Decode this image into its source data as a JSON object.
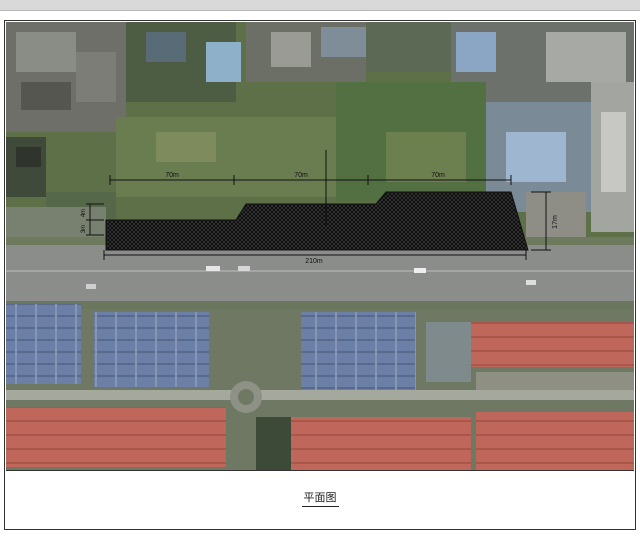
{
  "caption": "平面图",
  "dimensions": {
    "segment_1": "70m",
    "segment_2": "70m",
    "segment_3": "70m",
    "total_length": "210m",
    "height_right": "17m",
    "height_left_top": "4m",
    "height_left_bottom": "3m"
  },
  "colors": {
    "road": "#8a8d8a",
    "roof_red": "#c0675c",
    "roof_blue": "#6c7fa6",
    "vegetation": "#5f7f4a",
    "hatch": "#1a1a1a"
  }
}
